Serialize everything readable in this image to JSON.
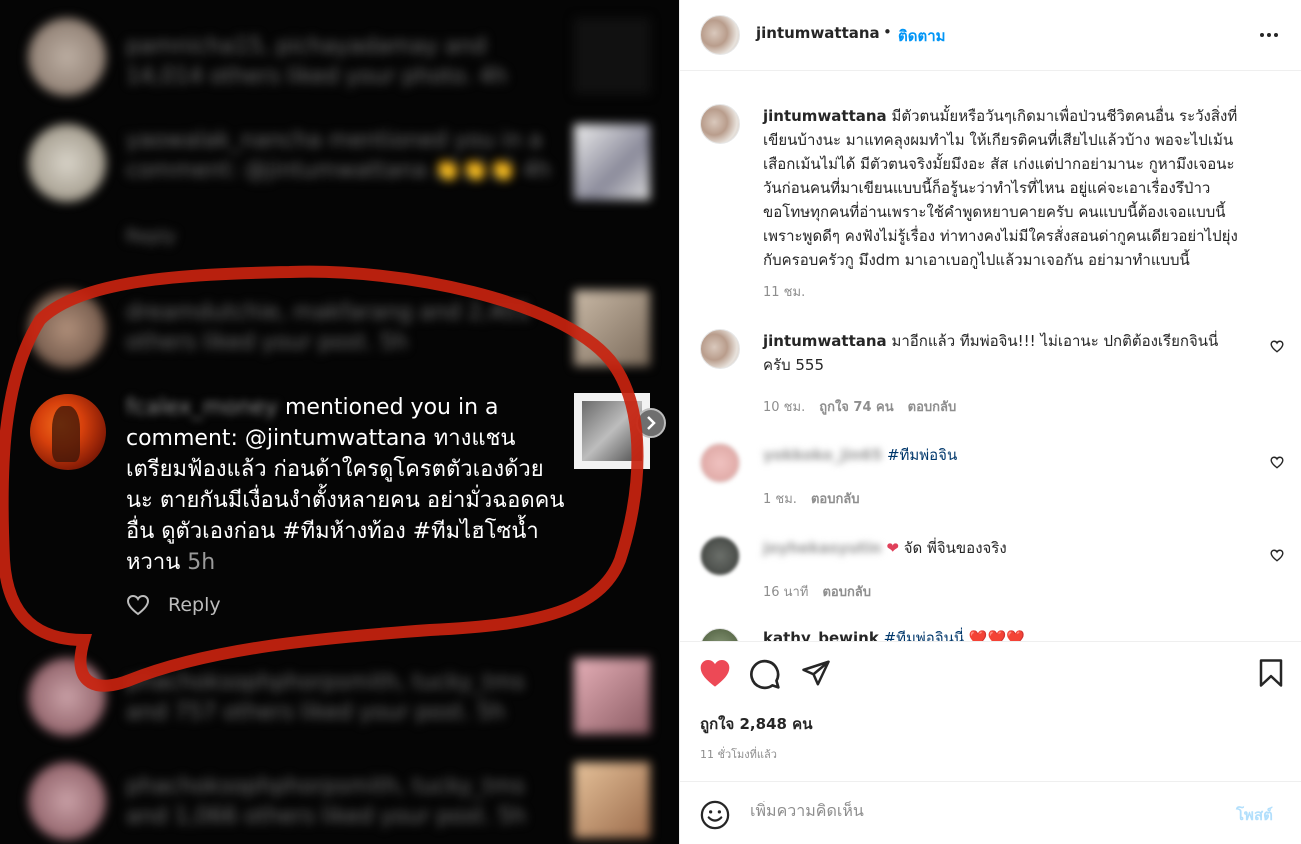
{
  "screenshot_post": {
    "focus_comment": {
      "username": "fcalex_money",
      "text": "mentioned you in a comment: @jintumwattana ทางแชนเตรียมฟ้องแล้ว ก่อนด้าใครดูโครตตัวเองด้วยนะ ตายกันมีเงื่อนงำตั้งหลายคน อย่ามั่วฉอดคนอื่น ดูตัวเองก่อน #ทีมห้างท้อง #ทีมไฮโซน้ำหวาน",
      "time": "5h",
      "reply_label": "Reply"
    },
    "blurred_rows": [
      "pamnicha15, pichayadamay and 14,014 others liked your photo. 4h",
      "yaowalak_nancha mentioned you in a comment: @jintumwattana 👏👏👏 4h",
      "dreamdutchie, makfarang and 2,401 others liked your post. 5h",
      "phachoksophphorpsmith, tucky_tms and 757 others liked your post. 5h",
      "phachoksophphorpsmith, tucky_tms and 1,066 others liked your post. 5h"
    ],
    "blurred_reply_label": "Reply"
  },
  "header": {
    "username": "jintumwattana",
    "dot": "•",
    "follow_label": "ติดตาม"
  },
  "caption": {
    "username": "jintumwattana",
    "text": "มีตัวตนมั้ยหรือวันๆเกิดมาเพื่อป่วนชีวิตคนอื่น ระวังสิ่งที่เขียนบ้างนะ มาแทคลุงผมทำไม ให้เกียรติคนที่เสียไปแล้วบ้าง พอจะไปเม้นเสือกเม้นไม่ได้ มีตัวตนจริงมั้ยมึงอะ สัส เก่งแต่ปากอย่ามานะ กูหามึงเจอนะวันก่อนคนที่มาเขียนแบบนี้ก็อรู้นะว่าทำไรที่ไหน อยู่แค่จะเอาเรื่องรึป่าว ขอโทษทุกคนที่อ่านเพราะใช้คำพูดหยาบคายครับ คนแบบนี้ต้องเจอแบบนี้ เพราะพูดดีๆ คงฟังไม่รู้เรื่อง ท่าทางคงไม่มีใครสั่งสอนด่ากูคนเดียวอย่าไปยุ่งกับครอบครัวกู มึงdm มาเอาเบอกูไปแล้วมาเจอกัน อย่ามาทำแบบนี้",
    "time": "11 ชม."
  },
  "comments": [
    {
      "username": "jintumwattana",
      "text": "มาอีกแล้ว ทีมพ่อจิน!!! ไม่เอานะ ปกติต้องเรียกจินนี่ครับ 555",
      "time": "10 ชม.",
      "likes": "ถูกใจ 74 คน",
      "reply": "ตอบกลับ"
    },
    {
      "username": "yokkoko_jin65",
      "text": "#ทีมพ่อจิน",
      "time": "1 ชม.",
      "reply": "ตอบกลับ"
    },
    {
      "username": "joyhekasyutin",
      "text": "จัด พี่จินของจริง",
      "time": "16 นาที",
      "reply": "ตอบกลับ"
    },
    {
      "username": "kathy_bewink",
      "text": "#ทีมพ่อจินนี่ ❤️❤️❤️"
    }
  ],
  "likes_text": "ถูกใจ 2,848 คน",
  "posted_time": "11 ชั่วโมงที่แล้ว",
  "add_comment": {
    "placeholder": "เพิ่มความคิดเห็น",
    "post_label": "โพสต์"
  },
  "icons": {
    "like": "heart-filled-icon",
    "comment": "comment-bubble-icon",
    "share": "paper-plane-icon",
    "save": "bookmark-icon",
    "emoji": "emoji-smile-icon",
    "more": "more-horizontal-icon"
  },
  "colors": {
    "like_red": "#ed4956",
    "link_blue": "#0095f6",
    "post_disabled": "#b2dffc",
    "annotation_red": "#c8230f"
  }
}
